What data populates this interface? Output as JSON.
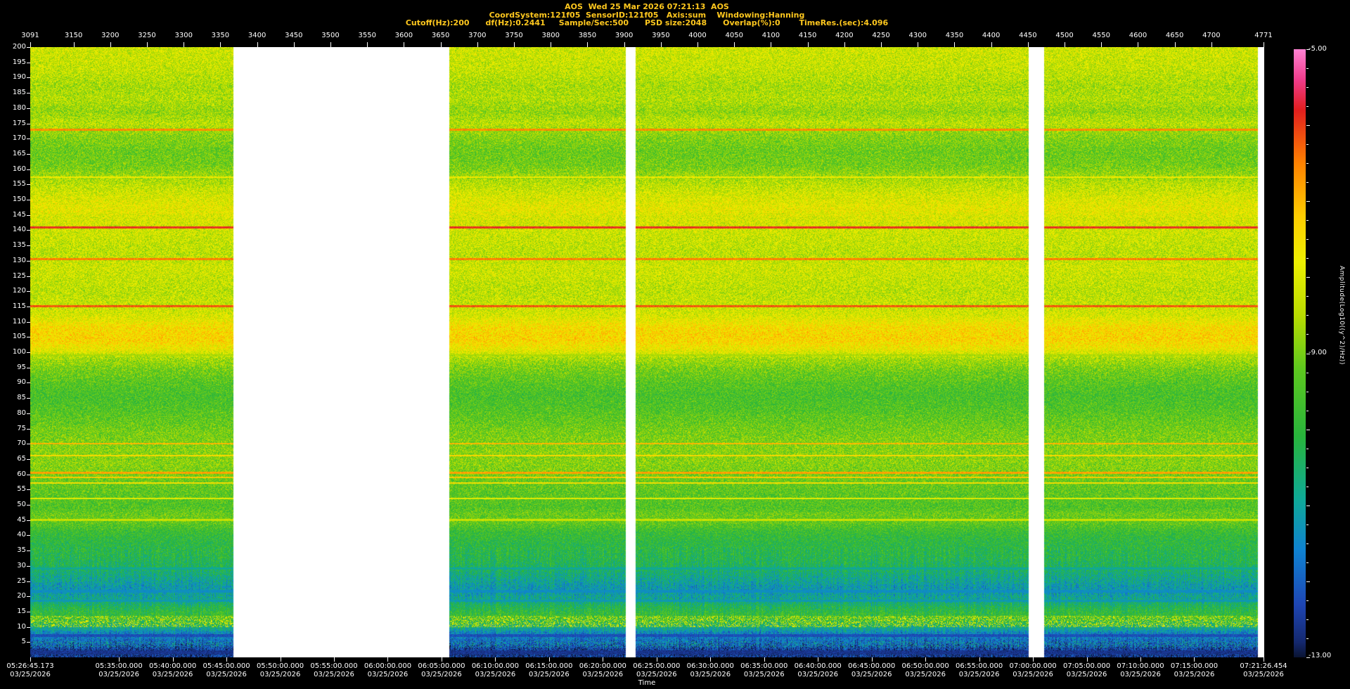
{
  "header": {
    "title": "AOS  Wed 25 Mar 2026 07:21:13  AOS",
    "params_line1": "CoordSystem:121f05  SensorID:121f05   Axis:sum    Windowing:Hanning",
    "params_line2": "Cutoff(Hz):200      df(Hz):0.2441     Sample/Sec:500      PSD size:2048      Overlap(%):0       TimeRes.(sec):4.096"
  },
  "axes": {
    "top": {
      "start": 3091,
      "end": 4771,
      "ticks": [
        3091,
        3150,
        3200,
        3250,
        3300,
        3350,
        3400,
        3450,
        3500,
        3550,
        3600,
        3650,
        3700,
        3750,
        3800,
        3850,
        3900,
        3950,
        4000,
        4050,
        4100,
        4150,
        4200,
        4250,
        4300,
        4350,
        4400,
        4450,
        4500,
        4550,
        4600,
        4650,
        4700,
        4771
      ]
    },
    "left": {
      "min": 0,
      "max": 200,
      "unit": "Hz",
      "ticks": [
        200,
        195,
        190,
        185,
        180,
        175,
        170,
        165,
        160,
        155,
        150,
        145,
        140,
        135,
        130,
        125,
        120,
        115,
        110,
        105,
        100,
        95,
        90,
        85,
        80,
        75,
        70,
        65,
        60,
        55,
        50,
        45,
        40,
        35,
        30,
        25,
        20,
        15,
        10,
        5
      ]
    },
    "bottom": {
      "label": "Time",
      "ticks": [
        {
          "time": "05:26:45.173",
          "date": "03/25/2026"
        },
        {
          "time": "05:35:00.000",
          "date": "03/25/2026"
        },
        {
          "time": "05:40:00.000",
          "date": "03/25/2026"
        },
        {
          "time": "05:45:00.000",
          "date": "03/25/2026"
        },
        {
          "time": "05:50:00.000",
          "date": "03/25/2026"
        },
        {
          "time": "05:55:00.000",
          "date": "03/25/2026"
        },
        {
          "time": "06:00:00.000",
          "date": "03/25/2026"
        },
        {
          "time": "06:05:00.000",
          "date": "03/25/2026"
        },
        {
          "time": "06:10:00.000",
          "date": "03/25/2026"
        },
        {
          "time": "06:15:00.000",
          "date": "03/25/2026"
        },
        {
          "time": "06:20:00.000",
          "date": "03/25/2026"
        },
        {
          "time": "06:25:00.000",
          "date": "03/25/2026"
        },
        {
          "time": "06:30:00.000",
          "date": "03/25/2026"
        },
        {
          "time": "06:35:00.000",
          "date": "03/25/2026"
        },
        {
          "time": "06:40:00.000",
          "date": "03/25/2026"
        },
        {
          "time": "06:45:00.000",
          "date": "03/25/2026"
        },
        {
          "time": "06:50:00.000",
          "date": "03/25/2026"
        },
        {
          "time": "06:55:00.000",
          "date": "03/25/2026"
        },
        {
          "time": "07:00:00.000",
          "date": "03/25/2026"
        },
        {
          "time": "07:05:00.000",
          "date": "03/25/2026"
        },
        {
          "time": "07:10:00.000",
          "date": "03/25/2026"
        },
        {
          "time": "07:15:00.000",
          "date": "03/25/2026"
        },
        {
          "time": "07:21:26.454",
          "date": "03/25/2026"
        }
      ]
    }
  },
  "colorbar": {
    "label": "Amplitude(Log10((y^2)/Hz))",
    "max": -5,
    "min": -13,
    "ticks": [
      "-5.00",
      "-9.00",
      "-13.00"
    ]
  },
  "chart_data": {
    "type": "heatmap",
    "subtype": "spectrogram",
    "x_axis": {
      "unit": "record",
      "start": 3091,
      "end": 4771
    },
    "time_axis": {
      "start": "05:26:45.173",
      "end": "07:21:26.454",
      "date": "03/25/2026"
    },
    "freq_axis": {
      "min": 0,
      "max": 200,
      "unit": "Hz"
    },
    "amplitude_range": [
      -13,
      -5
    ],
    "gap_color": "#ffffff",
    "gaps_frac": [
      [
        0.1648,
        0.3399
      ],
      [
        0.4829,
        0.4906
      ],
      [
        0.8097,
        0.8221
      ],
      [
        0.996,
        1.0
      ]
    ],
    "noise_db": 1.5,
    "profile": [
      [
        200,
        -8.2
      ],
      [
        193,
        -8.3
      ],
      [
        187,
        -8.6
      ],
      [
        183,
        -8.5
      ],
      [
        179,
        -8.8
      ],
      [
        175,
        -8.4
      ],
      [
        171,
        -8.9
      ],
      [
        166,
        -9.2
      ],
      [
        161,
        -9.1
      ],
      [
        156,
        -8.5
      ],
      [
        151,
        -8.1
      ],
      [
        147,
        -7.9
      ],
      [
        144,
        -8.1
      ],
      [
        140,
        -8.2
      ],
      [
        136,
        -8.3
      ],
      [
        132,
        -8.4
      ],
      [
        128,
        -8.2
      ],
      [
        124,
        -8.3
      ],
      [
        120,
        -8.4
      ],
      [
        116,
        -8.3
      ],
      [
        112,
        -8.1
      ],
      [
        108,
        -7.5
      ],
      [
        104,
        -7.4
      ],
      [
        101,
        -7.8
      ],
      [
        98,
        -8.6
      ],
      [
        94,
        -9.1
      ],
      [
        90,
        -9.4
      ],
      [
        86,
        -9.6
      ],
      [
        82,
        -9.5
      ],
      [
        78,
        -9.3
      ],
      [
        74,
        -9.1
      ],
      [
        71,
        -9.0
      ],
      [
        68,
        -8.9
      ],
      [
        64,
        -8.9
      ],
      [
        61,
        -9.0
      ],
      [
        58,
        -9.2
      ],
      [
        55,
        -9.3
      ],
      [
        52,
        -9.4
      ],
      [
        49,
        -9.5
      ],
      [
        47,
        -9.2
      ],
      [
        44,
        -9.3
      ],
      [
        41,
        -9.8
      ],
      [
        38,
        -10.0
      ],
      [
        35,
        -10.1
      ],
      [
        32,
        -10.2
      ],
      [
        29,
        -10.4
      ],
      [
        27,
        -10.7
      ],
      [
        25,
        -10.9
      ],
      [
        23,
        -11.2
      ],
      [
        21,
        -11.1
      ],
      [
        19,
        -10.9
      ],
      [
        17,
        -10.4
      ],
      [
        15,
        -10.0
      ],
      [
        13,
        -9.8
      ],
      [
        11,
        -10.3
      ],
      [
        9,
        -11.0
      ],
      [
        8,
        -11.5
      ],
      [
        6,
        -11.7
      ],
      [
        4,
        -12.1
      ],
      [
        2,
        -12.5
      ],
      [
        0,
        -12.6
      ]
    ],
    "tonal_lines": [
      {
        "f": 173,
        "level": -6.6,
        "w": 0.35
      },
      {
        "f": 157.5,
        "level": -7.7,
        "w": 0.25
      },
      {
        "f": 141,
        "level": -5.9,
        "w": 0.4
      },
      {
        "f": 130.5,
        "level": -6.5,
        "w": 0.3
      },
      {
        "f": 115,
        "level": -6.2,
        "w": 0.35
      },
      {
        "f": 99,
        "level": -8.6,
        "w": 0.25
      },
      {
        "f": 70,
        "level": -7.0,
        "w": 0.3
      },
      {
        "f": 66,
        "level": -7.4,
        "w": 0.25
      },
      {
        "f": 60.5,
        "level": -6.8,
        "w": 0.3
      },
      {
        "f": 59,
        "level": -7.2,
        "w": 0.25
      },
      {
        "f": 57,
        "level": -7.5,
        "w": 0.25
      },
      {
        "f": 52,
        "level": -7.9,
        "w": 0.25
      },
      {
        "f": 45,
        "level": -8.3,
        "w": 0.3
      },
      {
        "f": 29,
        "level": -10.9,
        "w": 0.3
      },
      {
        "f": 21.5,
        "level": -11.4,
        "w": 0.5
      },
      {
        "f": 18.5,
        "level": -11.2,
        "w": 0.4
      },
      {
        "f": 7,
        "level": -12.2,
        "w": 0.5
      },
      {
        "f": 1.5,
        "level": -12.6,
        "w": 0.8
      }
    ],
    "patches": [
      {
        "f_lo": 9.8,
        "f_hi": 13.6,
        "x_from": 0.0,
        "x_to": 1.0,
        "density": 0.32,
        "level": -7.9,
        "spread": 0.8
      },
      {
        "f_lo": 3.2,
        "f_hi": 5.2,
        "x_from": 0.0,
        "x_to": 1.0,
        "density": 0.18,
        "level": -10.6,
        "spread": 0.6
      }
    ],
    "colormap": [
      {
        "v": -5.0,
        "c": "#ff82d2"
      },
      {
        "v": -5.4,
        "c": "#f03c8c"
      },
      {
        "v": -5.8,
        "c": "#e11e1e"
      },
      {
        "v": -6.5,
        "c": "#ff8200"
      },
      {
        "v": -7.2,
        "c": "#ffcd00"
      },
      {
        "v": -7.8,
        "c": "#eef000"
      },
      {
        "v": -8.5,
        "c": "#b9dc00"
      },
      {
        "v": -9.2,
        "c": "#5ec81e"
      },
      {
        "v": -10.1,
        "c": "#28b43c"
      },
      {
        "v": -10.9,
        "c": "#0faa96"
      },
      {
        "v": -11.6,
        "c": "#0f82d2"
      },
      {
        "v": -12.3,
        "c": "#1e46b4"
      },
      {
        "v": -12.8,
        "c": "#14286e"
      },
      {
        "v": -13.0,
        "c": "#0a1432"
      }
    ]
  }
}
